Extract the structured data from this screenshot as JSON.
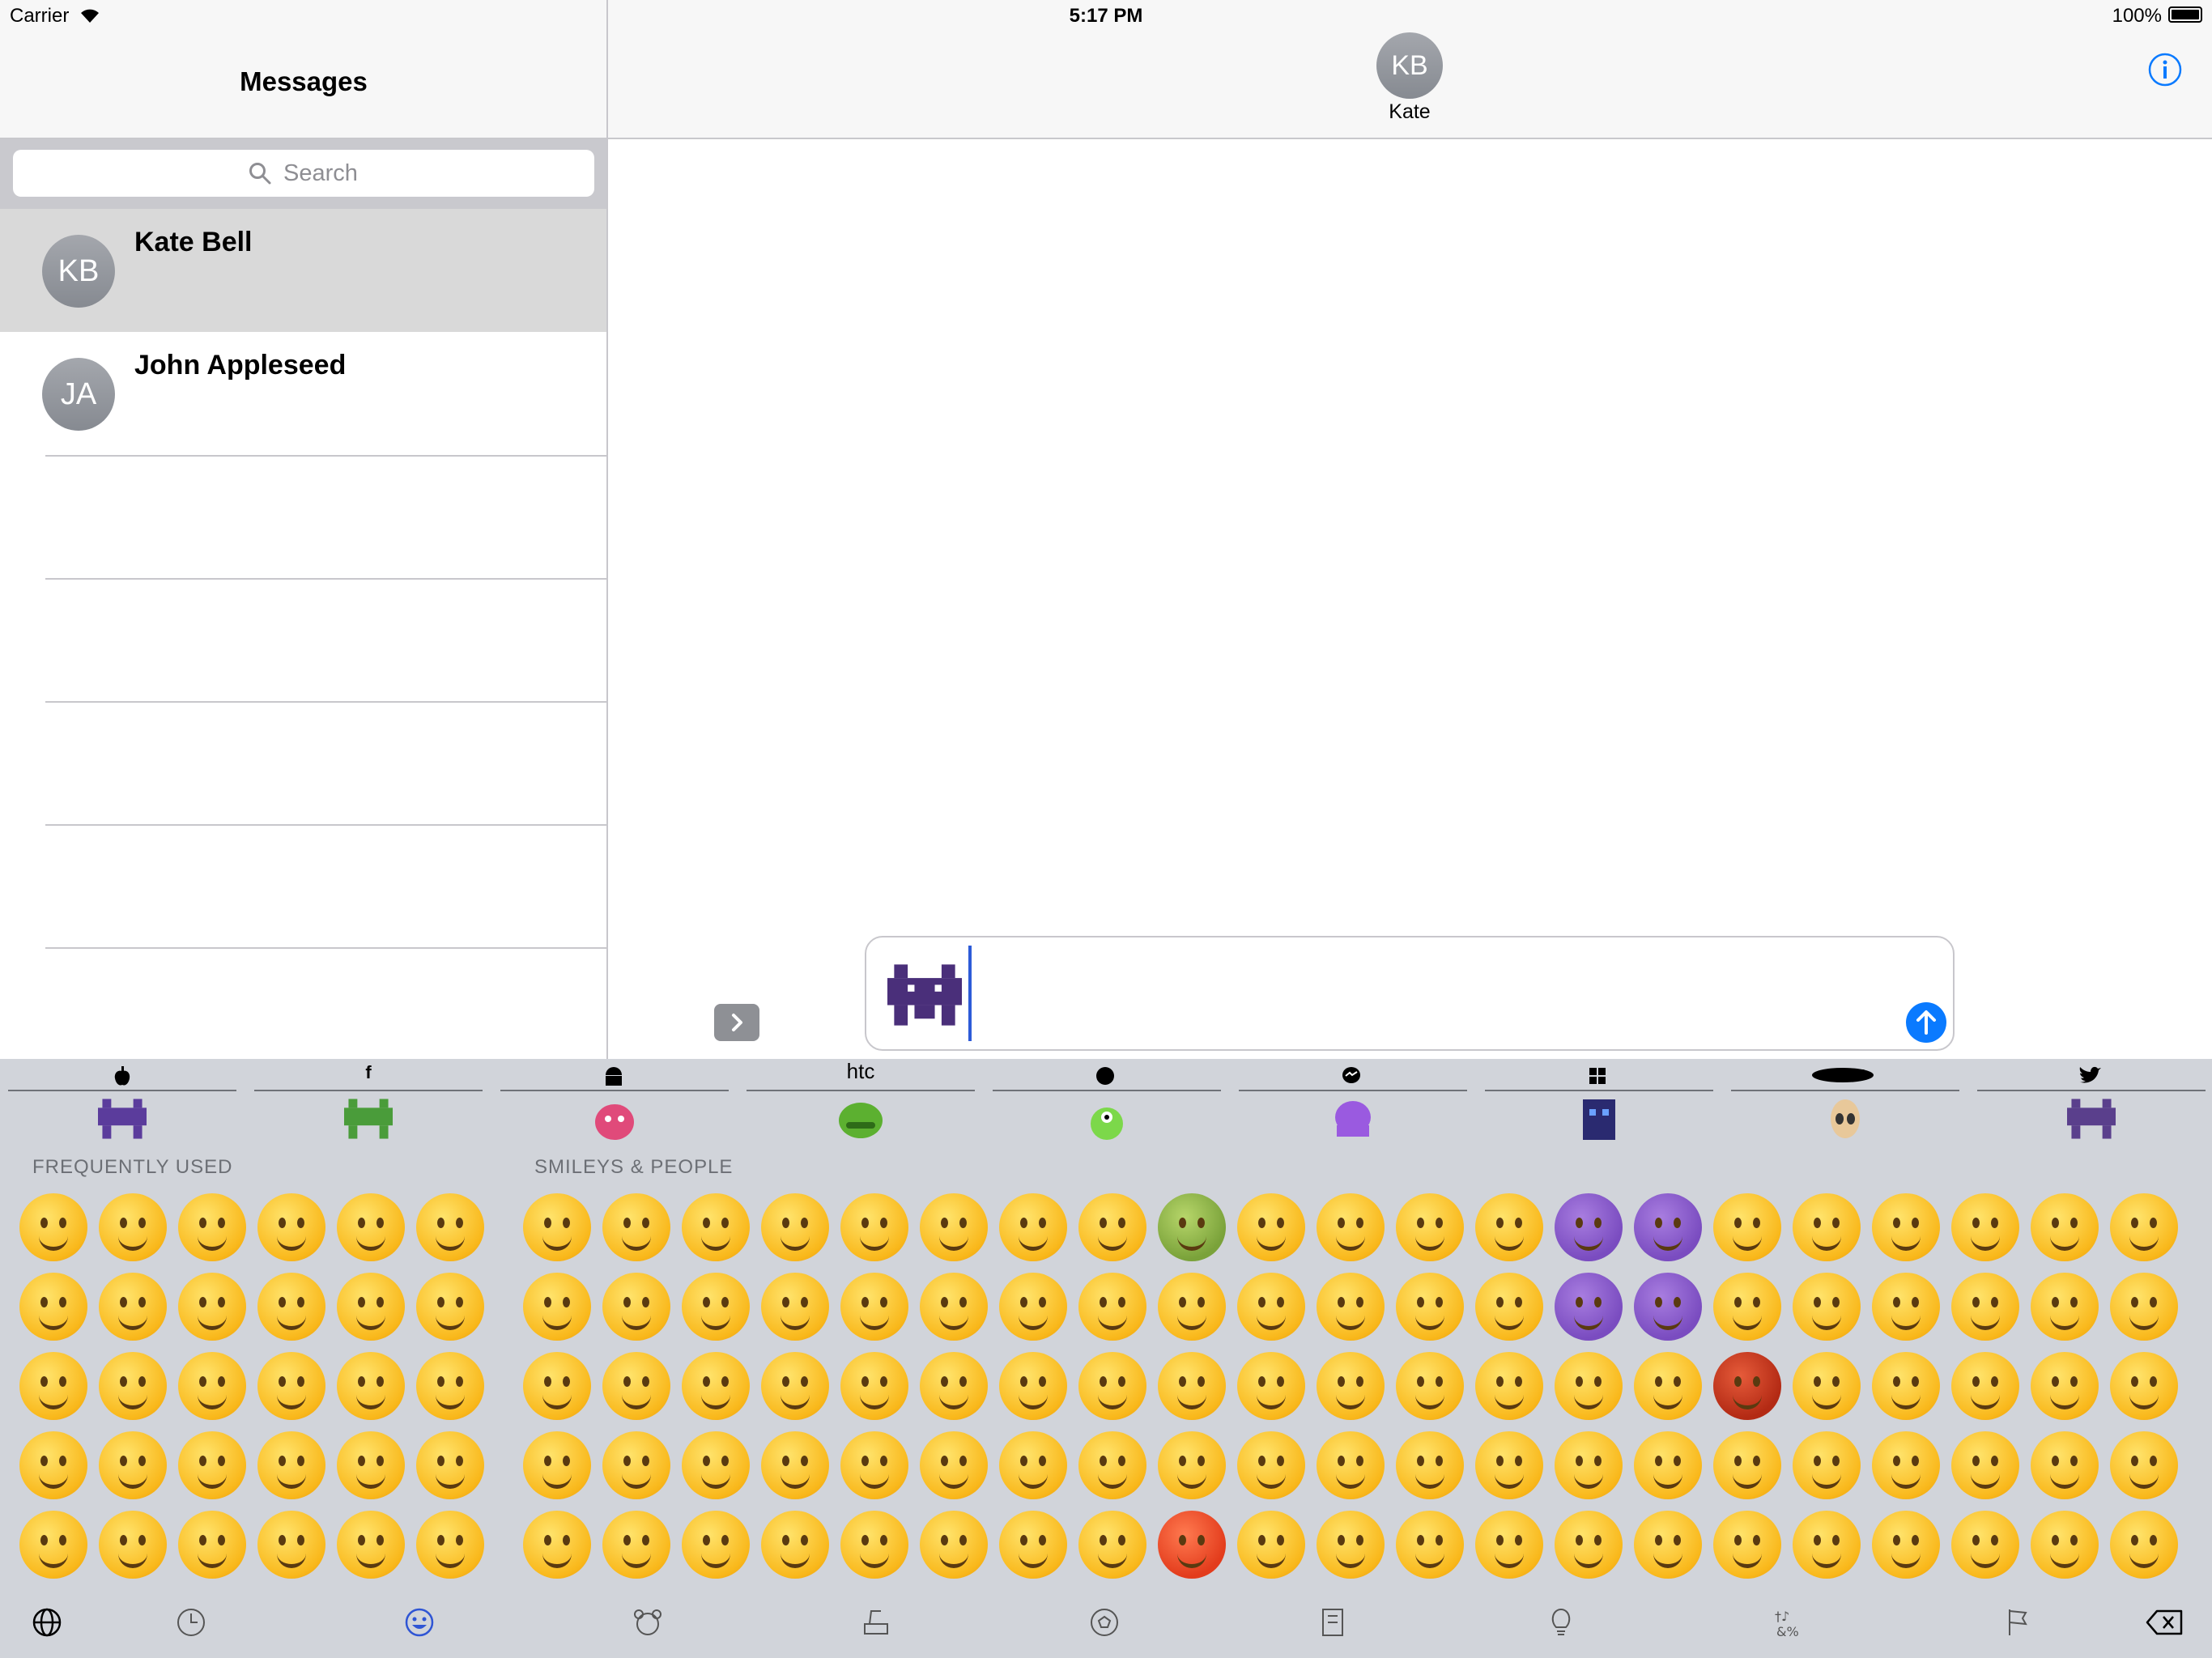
{
  "status_bar": {
    "carrier": "Carrier",
    "time": "5:17 PM",
    "battery": "100%"
  },
  "left_pane": {
    "title": "Messages",
    "search_placeholder": "Search",
    "conversations": [
      {
        "initials": "KB",
        "name": "Kate Bell",
        "selected": true
      },
      {
        "initials": "JA",
        "name": "John Appleseed",
        "selected": false
      }
    ]
  },
  "right_pane": {
    "contact_initials": "KB",
    "contact_name": "Kate",
    "info_icon": "info-icon"
  },
  "composer": {
    "message_content": "purple-space-invader-emoji",
    "send_icon": "arrow-up-icon",
    "expand_icon": "chevron-right-icon"
  },
  "keyboard": {
    "brand_tabs": [
      {
        "name": "apple",
        "logo": ""
      },
      {
        "name": "facebook",
        "logo": "f"
      },
      {
        "name": "android",
        "logo": ""
      },
      {
        "name": "htc",
        "logo": "htc"
      },
      {
        "name": "emojione",
        "logo": ""
      },
      {
        "name": "messenger",
        "logo": ""
      },
      {
        "name": "windows",
        "logo": ""
      },
      {
        "name": "samsung",
        "logo": "SAMSUNG"
      },
      {
        "name": "twitter",
        "logo": ""
      }
    ],
    "section_frequent": "FREQUENTLY USED",
    "section_smileys": "SMILEYS & PEOPLE",
    "bottom_icons": [
      "globe-icon",
      "clock-icon",
      "smiley-icon",
      "animal-icon",
      "food-icon",
      "ball-icon",
      "building-icon",
      "lightbulb-icon",
      "symbols-icon",
      "flag-icon",
      "backspace-icon"
    ],
    "active_color": "#2f55d4"
  },
  "colors": {
    "accent": "#0a7aff",
    "invader": "#5b3c9c"
  }
}
